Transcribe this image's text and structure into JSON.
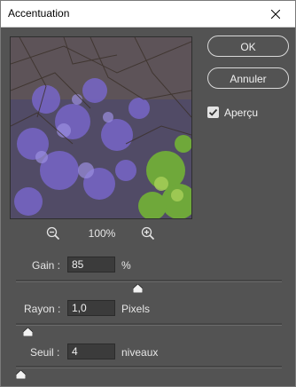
{
  "window": {
    "title": "Accentuation",
    "close_icon": "close-icon"
  },
  "preview": {
    "zoom_value": "100%",
    "zoom_out_icon": "zoom-out-icon",
    "zoom_in_icon": "zoom-in-icon"
  },
  "buttons": {
    "ok_label": "OK",
    "cancel_label": "Annuler"
  },
  "apercu": {
    "label": "Aperçu",
    "checked": true
  },
  "fields": {
    "gain": {
      "label": "Gain :",
      "value": "85",
      "unit": "%",
      "slider_fraction": 0.46
    },
    "rayon": {
      "label": "Rayon :",
      "value": "1,0",
      "unit": "Pixels",
      "slider_fraction": 0.04
    },
    "seuil": {
      "label": "Seuil :",
      "value": "4",
      "unit": "niveaux",
      "slider_fraction": 0.02
    }
  },
  "colors": {
    "dialog_bg": "#535353",
    "field_bg": "#3b3b3b",
    "text": "#e6e6e6"
  }
}
